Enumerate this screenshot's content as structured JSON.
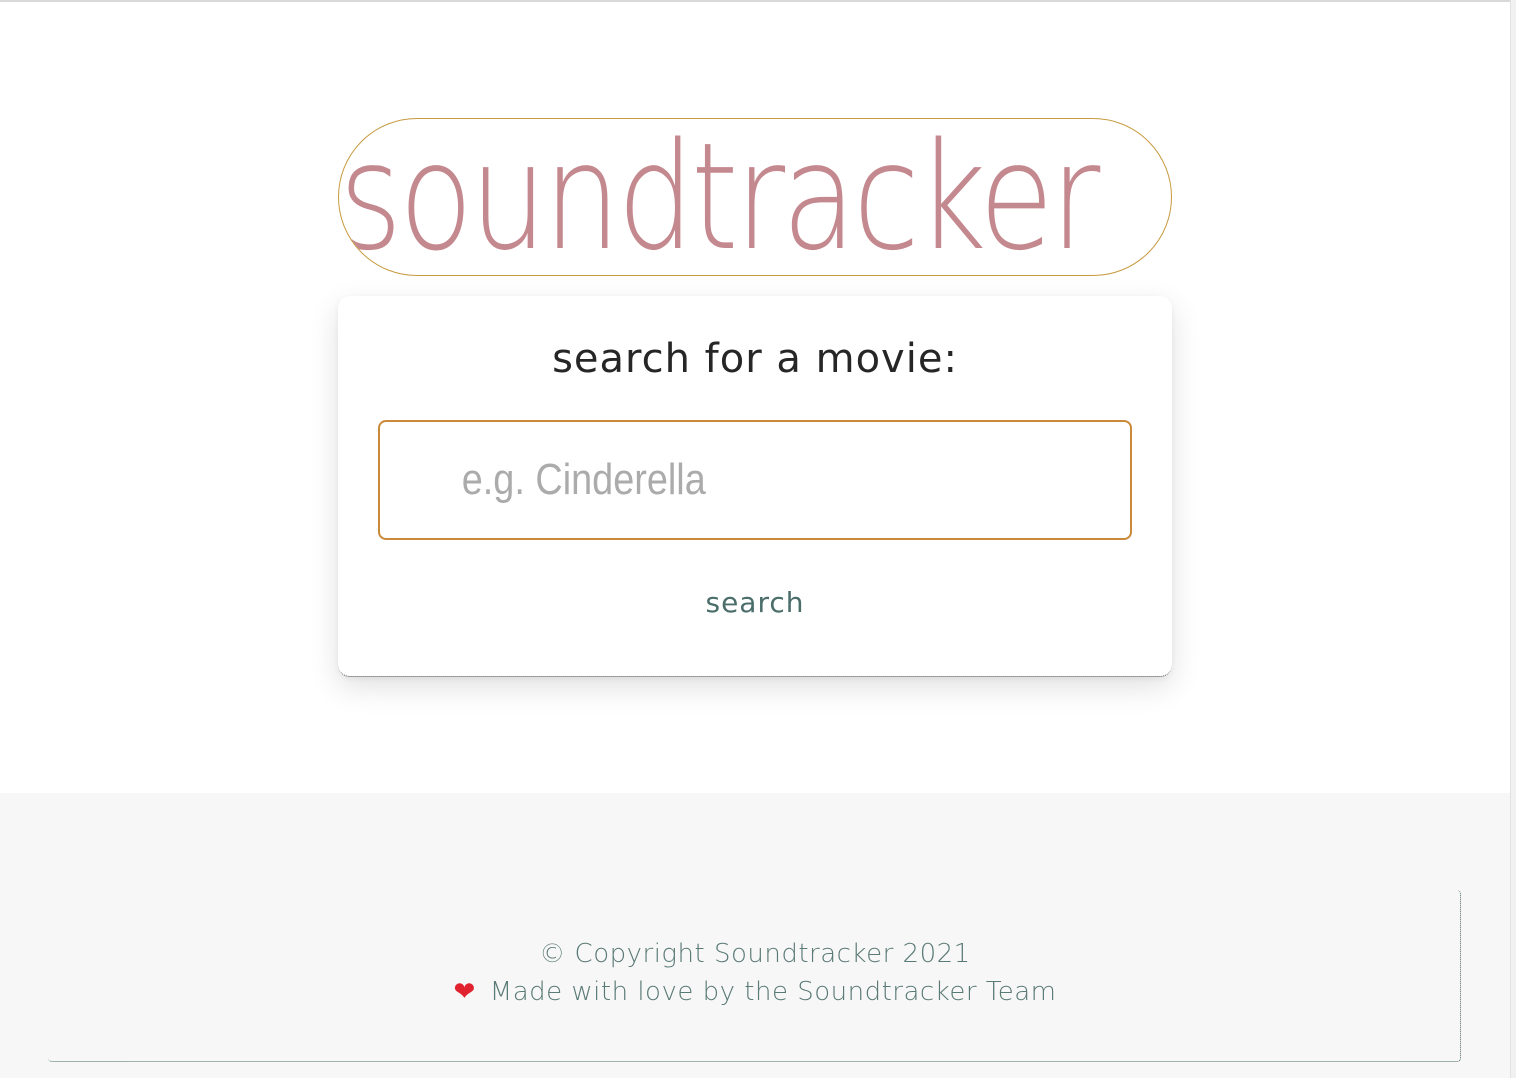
{
  "header": {
    "logo_text": "soundtracker"
  },
  "search": {
    "heading": "search for a movie:",
    "input_value": "",
    "input_placeholder": "e.g. Cinderella",
    "button_label": "search"
  },
  "footer": {
    "copyright": "© Copyright Soundtracker 2021",
    "heart_icon": "heart-icon",
    "made_with_love": "Made with love by the Soundtracker Team"
  },
  "colors": {
    "logo_text": "#c4888f",
    "logo_border": "#c79a3f",
    "input_border": "#c98a3a",
    "button_text": "#4b6e6b",
    "footer_text": "#5a7a76",
    "footer_bg": "#f7f7f7",
    "heart": "#e0232f"
  }
}
